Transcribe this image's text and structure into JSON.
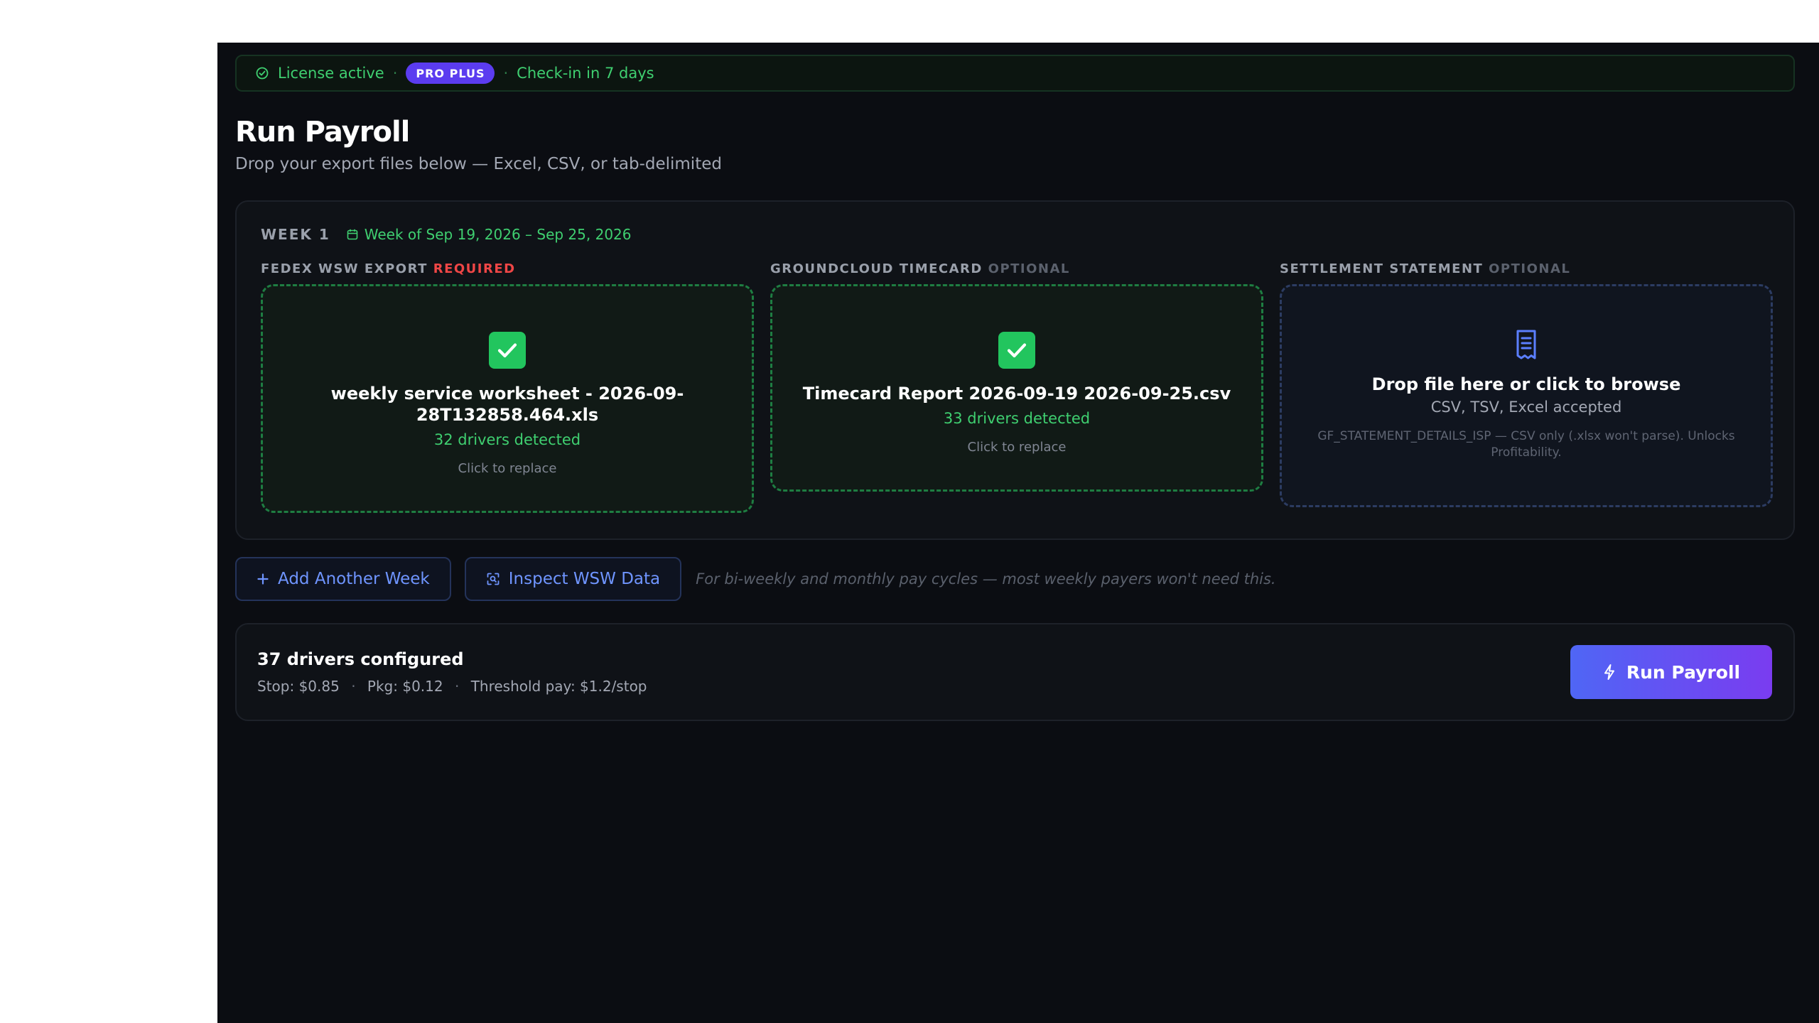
{
  "license": {
    "status": "License active",
    "plan": "PRO PLUS",
    "checkin": "Check-in in 7 days",
    "separator": "·"
  },
  "page": {
    "title": "Run Payroll",
    "subtitle": "Drop your export files below — Excel, CSV, or tab-delimited"
  },
  "week": {
    "label": "WEEK 1",
    "date_range": "Week of Sep 19, 2026 – Sep 25, 2026",
    "slots": [
      {
        "label": "FEDEX WSW EXPORT",
        "tag": "REQUIRED",
        "file_name": "weekly service worksheet - 2026-09-28T132858.464.xls",
        "detected": "32 drivers detected",
        "action": "Click to replace"
      },
      {
        "label": "GROUNDCLOUD TIMECARD",
        "tag": "OPTIONAL",
        "file_name": "Timecard Report 2026-09-19 2026-09-25.csv",
        "detected": "33 drivers detected",
        "action": "Click to replace"
      },
      {
        "label": "SETTLEMENT STATEMENT",
        "tag": "OPTIONAL",
        "drop_title": "Drop file here or click to browse",
        "accepted": "CSV, TSV, Excel accepted",
        "note": "GF_STATEMENT_DETAILS_ISP — CSV only (.xlsx won't parse). Unlocks Profitability."
      }
    ]
  },
  "actions": {
    "add_week": "Add Another Week",
    "inspect": "Inspect WSW Data",
    "hint": "For bi-weekly and monthly pay cycles — most weekly payers won't need this."
  },
  "summary": {
    "drivers": "37 drivers configured",
    "stop_rate": "Stop: $0.85",
    "pkg_rate": "Pkg: $0.12",
    "threshold": "Threshold pay: $1.2/stop",
    "separator": "·",
    "run_button": "Run Payroll"
  },
  "colors": {
    "accent_green": "#22c55e",
    "accent_blue": "#4f66f5",
    "accent_purple": "#7a3cf0",
    "required_red": "#ef4646",
    "background": "#0b0d12"
  },
  "icons": {
    "license": "check-circle-icon",
    "calendar": "calendar-icon",
    "file_ok": "check-square-icon",
    "receipt": "receipt-icon",
    "add": "plus-icon",
    "inspect": "scan-icon",
    "run": "lightning-icon"
  }
}
